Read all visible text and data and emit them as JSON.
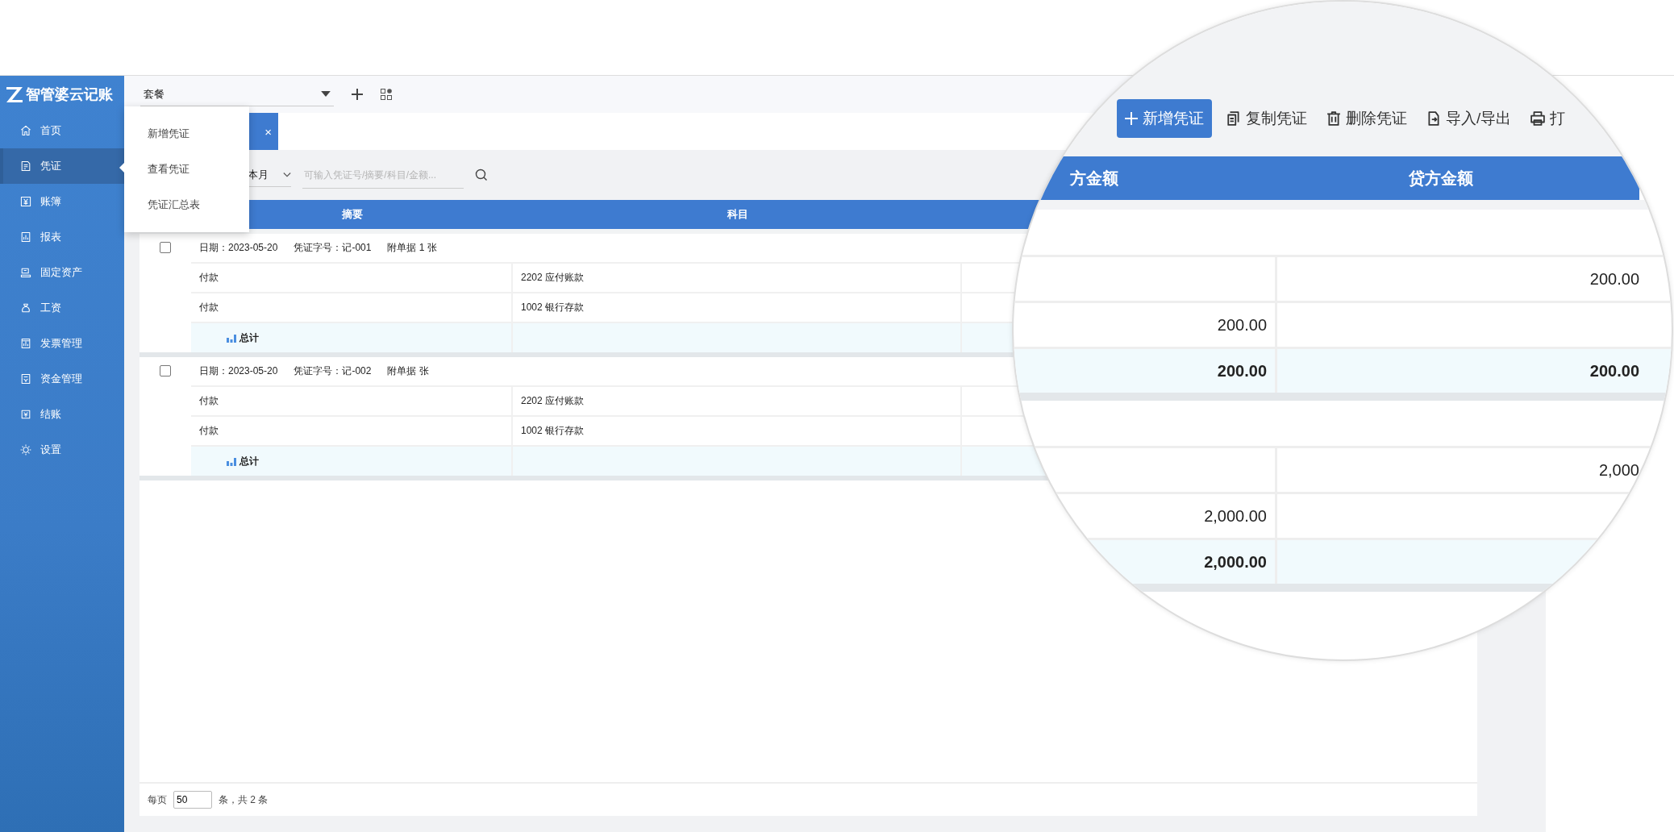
{
  "logo": {
    "text": "智管婆云记账"
  },
  "sidebar": {
    "items": [
      {
        "label": "首页",
        "selected": false
      },
      {
        "label": "凭证",
        "selected": true
      },
      {
        "label": "账簿",
        "selected": false
      },
      {
        "label": "报表",
        "selected": false
      },
      {
        "label": "固定资产",
        "selected": false
      },
      {
        "label": "工资",
        "selected": false
      },
      {
        "label": "发票管理",
        "selected": false
      },
      {
        "label": "资金管理",
        "selected": false
      },
      {
        "label": "结账",
        "selected": false
      },
      {
        "label": "设置",
        "selected": false
      }
    ]
  },
  "topbar": {
    "package_select": {
      "value": "套餐"
    }
  },
  "menu": {
    "items": [
      "新增凭证",
      "查看凭证",
      "凭证汇总表"
    ]
  },
  "tab": {
    "close": "×",
    "selected": true
  },
  "filter": {
    "period": "本月",
    "search": {
      "placeholder": "可输入凭证号/摘要/科目/金额..."
    }
  },
  "table": {
    "columns": [
      "摘要",
      "科目"
    ],
    "vouchers": [
      {
        "checked": false,
        "date": "日期：2023-05-20",
        "number": "凭证字号：记-001",
        "attachments": "附单据 1 张",
        "rows": [
          {
            "summary": "付款",
            "account": "2202  应付账款"
          },
          {
            "summary": "付款",
            "account": "1002  银行存款"
          }
        ],
        "total_label": "总计"
      },
      {
        "checked": false,
        "date": "日期：2023-05-20",
        "number": "凭证字号：记-002",
        "attachments": "附单据  张",
        "rows": [
          {
            "summary": "付款",
            "account": "2202  应付账款"
          },
          {
            "summary": "付款",
            "account": "1002  银行存款"
          }
        ],
        "total_label": "总计"
      }
    ]
  },
  "pagination": {
    "per_page_label": "每页",
    "per_page": "50",
    "total": "条，共 2 条"
  },
  "magnifier": {
    "toolbar": [
      {
        "label": "新增凭证",
        "kind": "add"
      },
      {
        "label": "复制凭证",
        "kind": "copy"
      },
      {
        "label": "删除凭证",
        "kind": "delete"
      },
      {
        "label": "导入/导出",
        "kind": "transfer"
      },
      {
        "label": "打",
        "kind": "print"
      }
    ],
    "columns": [
      "方金额",
      "贷方金额"
    ],
    "vouchers": [
      {
        "rows": [
          {
            "credit": "200.00"
          },
          {
            "debit": "200.00"
          }
        ],
        "total": {
          "debit": "200.00",
          "credit": "200.00"
        }
      },
      {
        "rows": [
          {
            "credit": "2,000"
          },
          {
            "debit": "2,000.00"
          }
        ],
        "total": {
          "debit": "2,000.00"
        }
      }
    ]
  }
}
